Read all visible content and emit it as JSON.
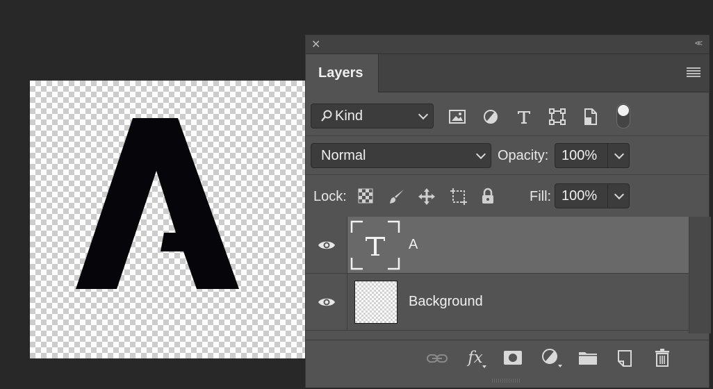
{
  "canvas": {
    "glyph": "A"
  },
  "panel": {
    "title": "Layers",
    "close_icon": "close-icon",
    "collapse_icon": "collapse-icon",
    "menu_icon": "panel-menu-icon"
  },
  "filter": {
    "kind_label": "Kind",
    "icons": [
      "image-filter-icon",
      "adjustment-filter-icon",
      "type-filter-icon",
      "shape-filter-icon",
      "smart-object-filter-icon"
    ]
  },
  "blend": {
    "mode": "Normal",
    "opacity_label": "Opacity:",
    "opacity_value": "100%"
  },
  "lock": {
    "label": "Lock:",
    "fill_label": "Fill:",
    "fill_value": "100%"
  },
  "layers": [
    {
      "name": "A",
      "type": "text",
      "selected": true,
      "visible": true
    },
    {
      "name": "Background",
      "type": "transparent",
      "selected": false,
      "visible": true
    }
  ],
  "bottom_toolbar": [
    "link-layers-icon",
    "fx-icon",
    "mask-icon",
    "adjustment-icon",
    "group-folder-icon",
    "new-layer-icon",
    "trash-icon"
  ],
  "fx_label": "fx"
}
